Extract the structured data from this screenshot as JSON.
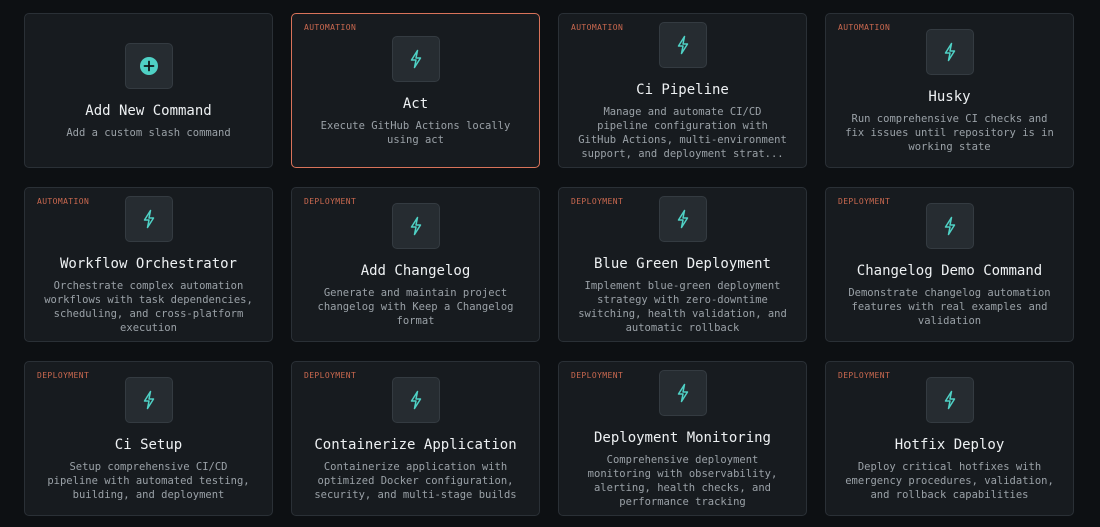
{
  "accent_color": "#4fd1c5",
  "selected_border_color": "#d9735a",
  "commands": [
    {
      "tag": "",
      "icon": "plus-circle-icon",
      "title": "Add New Command",
      "description": "Add a custom slash command"
    },
    {
      "tag": "AUTOMATION",
      "icon": "lightning-icon",
      "title": "Act",
      "description": "Execute GitHub Actions locally using act",
      "selected": true
    },
    {
      "tag": "AUTOMATION",
      "icon": "lightning-icon",
      "title": "Ci Pipeline",
      "description": "Manage and automate CI/CD pipeline configuration with GitHub Actions, multi-environment support, and deployment strat..."
    },
    {
      "tag": "AUTOMATION",
      "icon": "lightning-icon",
      "title": "Husky",
      "description": "Run comprehensive CI checks and fix issues until repository is in working state"
    },
    {
      "tag": "AUTOMATION",
      "icon": "lightning-icon",
      "title": "Workflow Orchestrator",
      "description": "Orchestrate complex automation workflows with task dependencies, scheduling, and cross-platform execution"
    },
    {
      "tag": "DEPLOYMENT",
      "icon": "lightning-icon",
      "title": "Add Changelog",
      "description": "Generate and maintain project changelog with Keep a Changelog format"
    },
    {
      "tag": "DEPLOYMENT",
      "icon": "lightning-icon",
      "title": "Blue Green Deployment",
      "description": "Implement blue-green deployment strategy with zero-downtime switching, health validation, and automatic rollback"
    },
    {
      "tag": "DEPLOYMENT",
      "icon": "lightning-icon",
      "title": "Changelog Demo Command",
      "description": "Demonstrate changelog automation features with real examples and validation"
    },
    {
      "tag": "DEPLOYMENT",
      "icon": "lightning-icon",
      "title": "Ci Setup",
      "description": "Setup comprehensive CI/CD pipeline with automated testing, building, and deployment"
    },
    {
      "tag": "DEPLOYMENT",
      "icon": "lightning-icon",
      "title": "Containerize Application",
      "description": "Containerize application with optimized Docker configuration, security, and multi-stage builds"
    },
    {
      "tag": "DEPLOYMENT",
      "icon": "lightning-icon",
      "title": "Deployment Monitoring",
      "description": "Comprehensive deployment monitoring with observability, alerting, health checks, and performance tracking"
    },
    {
      "tag": "DEPLOYMENT",
      "icon": "lightning-icon",
      "title": "Hotfix Deploy",
      "description": "Deploy critical hotfixes with emergency procedures, validation, and rollback capabilities"
    }
  ]
}
